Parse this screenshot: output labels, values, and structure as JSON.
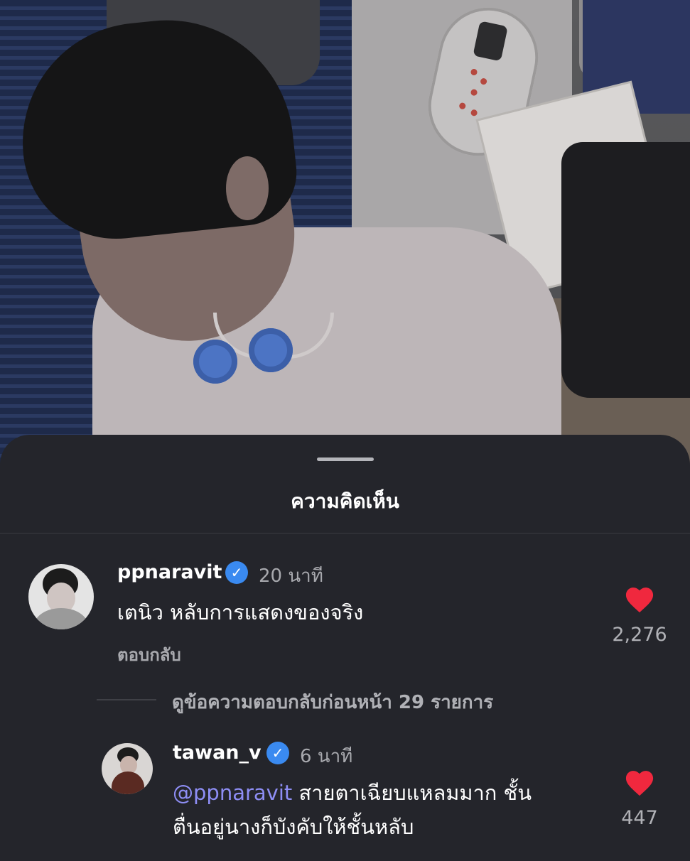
{
  "sheet": {
    "title": "ความคิดเห็น"
  },
  "comments": [
    {
      "username": "ppnaravit",
      "verified_icon": "verified-badge-icon",
      "time": "20 นาที",
      "text": "เตนิว หลับการแสดงของจริง",
      "reply_label": "ตอบกลับ",
      "likes": "2,276"
    }
  ],
  "view_previous_replies": "ดูข้อความตอบกลับก่อนหน้า 29 รายการ",
  "replies": [
    {
      "username": "tawan_v",
      "verified_icon": "verified-badge-icon",
      "time": "6 นาที",
      "mention": "@ppnaravit",
      "text_line1": " สายตาเฉียบแหลมมาก ชั้น",
      "text_line2": "ตื่นอยู่นางก็บังคับให้ชั้นหลับ",
      "likes": "447"
    }
  ],
  "colors": {
    "sheet_bg": "#24252b",
    "verified": "#3a8af0",
    "heart": "#f0283e",
    "mention": "#8e8ef5"
  }
}
